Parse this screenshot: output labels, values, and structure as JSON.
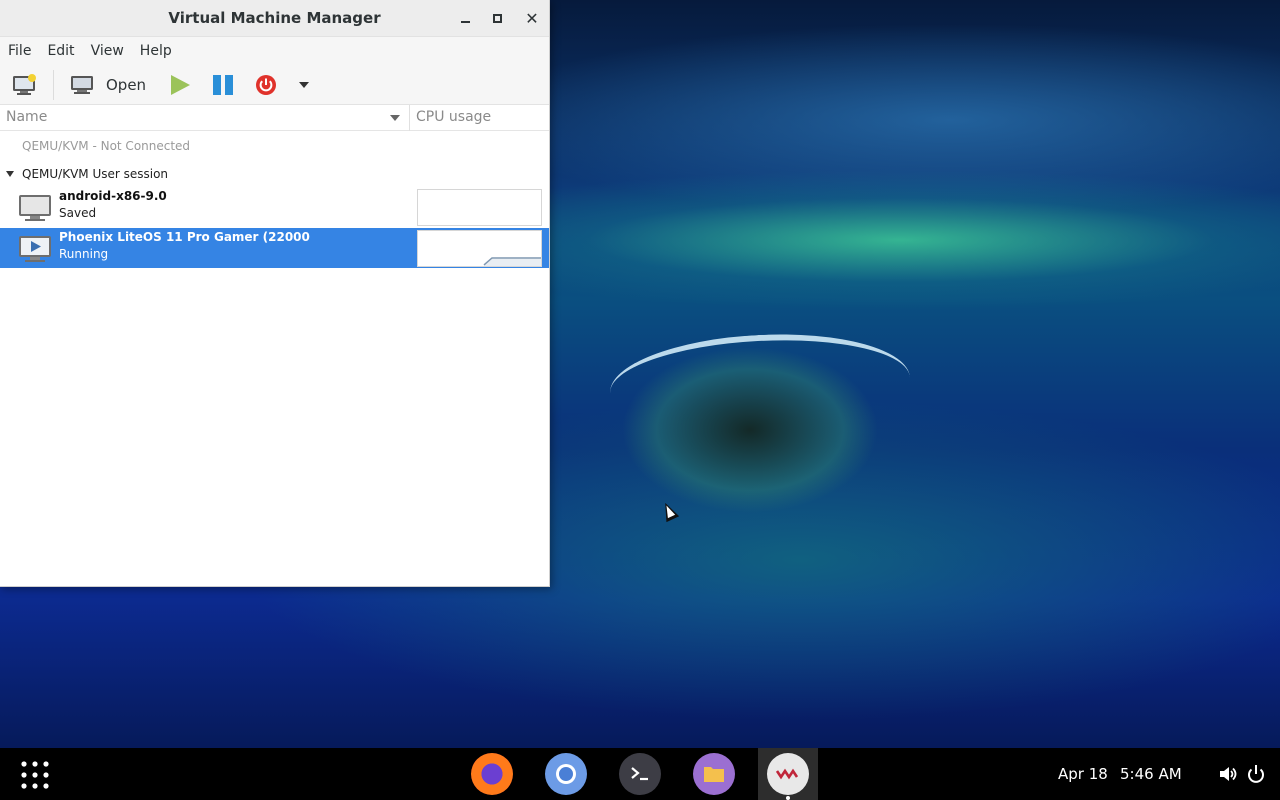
{
  "window": {
    "title": "Virtual Machine Manager"
  },
  "menu": [
    "File",
    "Edit",
    "View",
    "Help"
  ],
  "toolbar": {
    "open_label": "Open"
  },
  "columns": {
    "name": "Name",
    "cpu": "CPU usage"
  },
  "connections": [
    {
      "label": "QEMU/KVM - Not Connected"
    },
    {
      "label": "QEMU/KVM User session"
    }
  ],
  "vms": [
    {
      "name": "android-x86-9.0",
      "status": "Saved",
      "selected": false
    },
    {
      "name": "Phoenix LiteOS 11 Pro Gamer (22000",
      "status": "Running",
      "selected": true
    }
  ],
  "taskbar": {
    "date": "Apr 18",
    "time": "5:46 AM",
    "apps": [
      "firefox-icon",
      "chromium-icon",
      "terminal-icon",
      "files-icon",
      "virt-manager-icon"
    ]
  },
  "colors": {
    "selection": "#3584e4",
    "run_icon": "#8cc34a",
    "pause_icon": "#2a8fd8",
    "shutdown_icon": "#e0322b"
  }
}
